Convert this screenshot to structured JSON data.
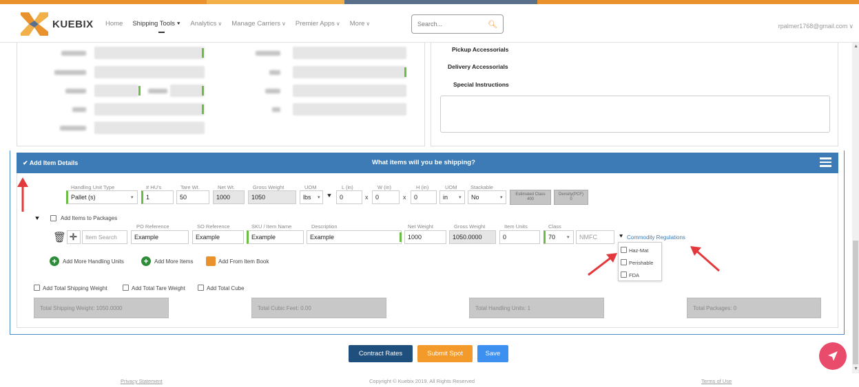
{
  "brand": {
    "name": "KUEBIX",
    "accent": "#e8912d",
    "header_blue": "#3c7bb6"
  },
  "nav": {
    "items": [
      {
        "label": "Home"
      },
      {
        "label": "Shipping Tools"
      },
      {
        "label": "Analytics"
      },
      {
        "label": "Manage Carriers"
      },
      {
        "label": "Premier Apps"
      },
      {
        "label": "More"
      }
    ],
    "search_placeholder": "Search...",
    "user_email": "rpalmer1768@gmail.com"
  },
  "pickup_panel": {
    "pickup_accessorials": "Pickup Accessorials",
    "delivery_accessorials": "Delivery Accessorials",
    "special_instructions": "Special Instructions"
  },
  "item_details": {
    "toggle_label": "Add Item Details",
    "header_title": "What items will you be shipping?",
    "handling_unit_headers": {
      "handling_unit_type": "Handling Unit Type",
      "hus": "# HU's",
      "tare_wt": "Tare Wt.",
      "net_wt": "Net Wt.",
      "gross_weight": "Gross Weight",
      "uom": "UOM",
      "l": "L (in)",
      "w": "W (in)",
      "h": "H (in)",
      "uom2": "UOM",
      "stackable": "Stackable"
    },
    "handling_unit_values": {
      "handling_unit_type": "Pallet (s)",
      "hus": "1",
      "tare_wt": "50",
      "net_wt": "1000",
      "gross_weight": "1050",
      "uom": "lbs",
      "l": "0",
      "w": "0",
      "h": "0",
      "uom2": "in",
      "stackable": "No"
    },
    "estimated_class": {
      "label": "Estimated Class",
      "value": "400"
    },
    "density": {
      "label": "Density(PCF)",
      "value": "0"
    },
    "add_items_to_packages": "Add Items to Packages",
    "item_headers": {
      "po_reference": "PO Reference",
      "so_reference": "SO Reference",
      "sku": "SKU / Item Name",
      "description": "Description",
      "net_weight": "Net Weight",
      "gross_weight": "Gross Weight",
      "item_units": "Item Units",
      "class": "Class"
    },
    "item_values": {
      "item_search_placeholder": "Item Search",
      "po_reference": "Example",
      "so_reference": "Example",
      "sku": "Example",
      "description": "Example",
      "net_weight": "1000",
      "gross_weight": "1050.0000",
      "item_units": "0",
      "class": "70",
      "nmfc_placeholder": "NMFC"
    },
    "commodity_regulations": "Commodity Regulations",
    "regulation_options": [
      "Haz-Mat",
      "Perishable",
      "FDA"
    ],
    "actions": {
      "add_handling_units": "Add More Handling Units",
      "add_items": "Add More Items",
      "add_from_book": "Add From Item Book"
    },
    "total_toggles": [
      "Add Total Shipping Weight",
      "Add Total Tare Weight",
      "Add Total Cube"
    ],
    "totals": {
      "shipping_weight": "Total Shipping Weight: 1050.0000",
      "cubic_feet": "Total Cubic Feet: 0.00",
      "handling_units": "Total Handling Units: 1",
      "packages": "Total Packages: 0"
    }
  },
  "buttons": {
    "contract_rates": "Contract Rates",
    "submit_spot": "Submit Spot",
    "save": "Save"
  },
  "footer": {
    "privacy": "Privacy Statement",
    "copyright": "Copyright © Kuebix 2019. All Rights Reserved",
    "terms": "Terms of Use"
  }
}
